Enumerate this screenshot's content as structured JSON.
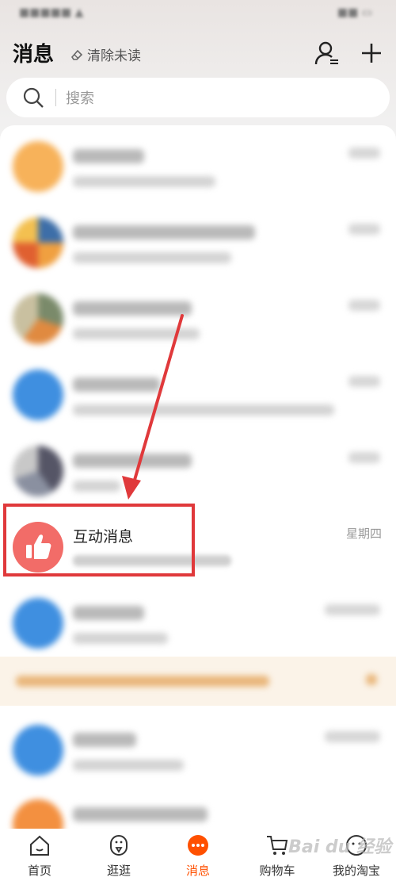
{
  "header": {
    "title": "消息",
    "clear_label": "清除未读"
  },
  "search": {
    "placeholder": "搜索"
  },
  "messages": [
    {
      "name": "",
      "time": "",
      "preview": ""
    },
    {
      "name": "",
      "time": "",
      "preview": ""
    },
    {
      "name": "",
      "time": "",
      "preview": ""
    },
    {
      "name": "",
      "time": "",
      "preview": ""
    },
    {
      "name": "",
      "time": "",
      "preview": ""
    },
    {
      "name": "互动消息",
      "time": "星期四",
      "preview": ""
    },
    {
      "name": "",
      "time": "",
      "preview": ""
    }
  ],
  "tabbar": {
    "items": [
      {
        "label": "首页",
        "icon": "home-icon"
      },
      {
        "label": "逛逛",
        "icon": "explore-icon"
      },
      {
        "label": "消息",
        "icon": "message-icon",
        "active": true
      },
      {
        "label": "购物车",
        "icon": "cart-icon"
      },
      {
        "label": "我的淘宝",
        "icon": "profile-icon"
      }
    ]
  },
  "watermark": {
    "text": "Bai du 经验"
  },
  "colors": {
    "accent": "#ff5000",
    "highlight": "#e0393b"
  }
}
